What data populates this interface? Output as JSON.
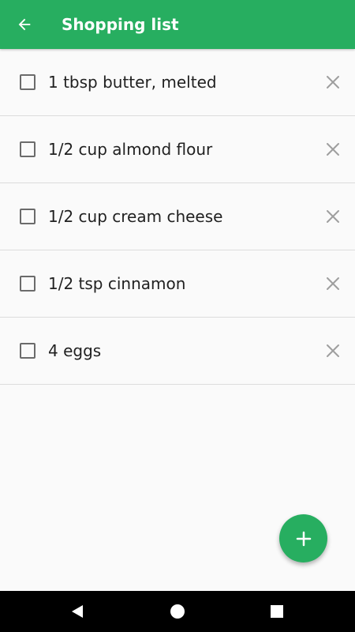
{
  "app_bar": {
    "title": "Shopping list",
    "back_icon": "arrow-left-icon",
    "color": "#27ae60"
  },
  "items": [
    {
      "label": "1 tbsp butter, melted",
      "checked": false
    },
    {
      "label": "1/2 cup almond flour",
      "checked": false
    },
    {
      "label": "1/2 cup cream cheese",
      "checked": false
    },
    {
      "label": "1/2 tsp cinnamon",
      "checked": false
    },
    {
      "label": "4 eggs",
      "checked": false
    }
  ],
  "fab": {
    "icon": "plus-icon",
    "color": "#27ae60"
  },
  "system_nav": {
    "back_icon": "triangle-back-icon",
    "home_icon": "circle-home-icon",
    "recents_icon": "square-recents-icon"
  }
}
